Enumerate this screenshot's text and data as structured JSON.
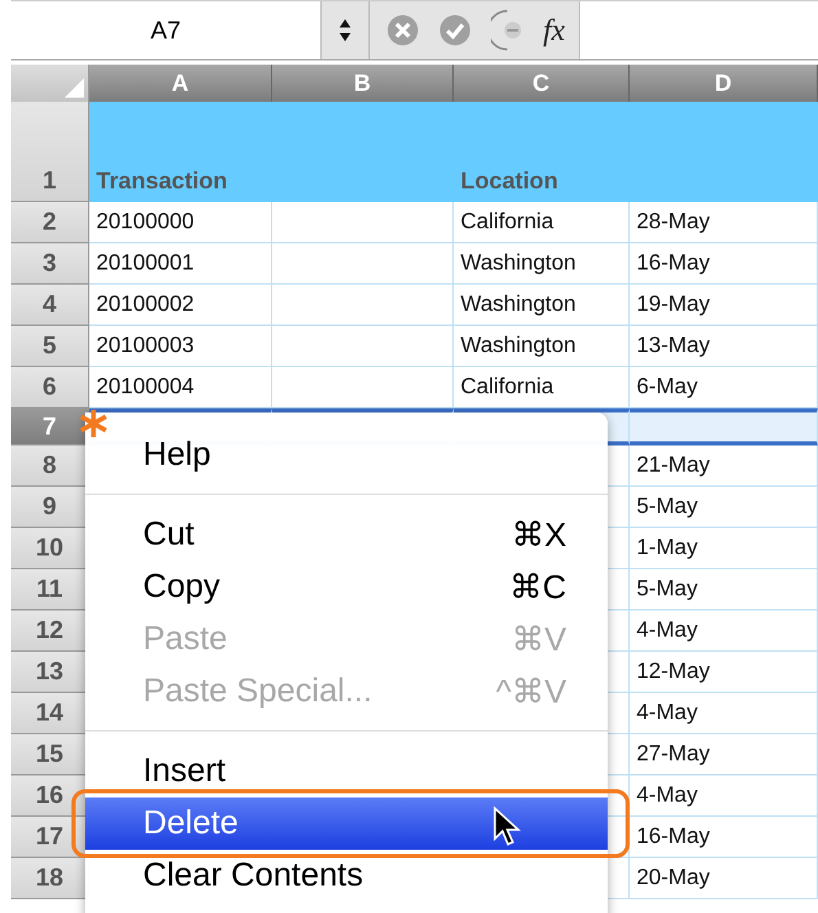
{
  "formula_bar": {
    "name_box": "A7",
    "function_label": "fx"
  },
  "columns": [
    {
      "label": "A"
    },
    {
      "label": "B"
    },
    {
      "label": "C"
    },
    {
      "label": "D"
    }
  ],
  "rows": [
    {
      "number": "1",
      "kind": "header",
      "selected": false,
      "marked": false,
      "a": "Transaction",
      "c": "Location"
    },
    {
      "number": "2",
      "kind": "data",
      "selected": false,
      "marked": false,
      "a": "20100000",
      "c": "California",
      "d": "28-May"
    },
    {
      "number": "3",
      "kind": "data",
      "selected": false,
      "marked": false,
      "a": "20100001",
      "c": "Washington",
      "d": "16-May"
    },
    {
      "number": "4",
      "kind": "data",
      "selected": false,
      "marked": false,
      "a": "20100002",
      "c": "Washington",
      "d": "19-May"
    },
    {
      "number": "5",
      "kind": "data",
      "selected": false,
      "marked": false,
      "a": "20100003",
      "c": "Washington",
      "d": "13-May"
    },
    {
      "number": "6",
      "kind": "data",
      "selected": false,
      "marked": false,
      "a": "20100004",
      "c": "California",
      "d": "6-May"
    },
    {
      "number": "7",
      "kind": "data",
      "selected": true,
      "marked": true
    },
    {
      "number": "8",
      "kind": "data",
      "selected": false,
      "marked": false,
      "d": "21-May"
    },
    {
      "number": "9",
      "kind": "data",
      "selected": false,
      "marked": false,
      "d": "5-May"
    },
    {
      "number": "10",
      "kind": "data",
      "selected": false,
      "marked": false,
      "d": "1-May"
    },
    {
      "number": "11",
      "kind": "data",
      "selected": false,
      "marked": false,
      "d": "5-May"
    },
    {
      "number": "12",
      "kind": "data",
      "selected": false,
      "marked": false,
      "d": "4-May"
    },
    {
      "number": "13",
      "kind": "data",
      "selected": false,
      "marked": false,
      "d": "12-May"
    },
    {
      "number": "14",
      "kind": "data",
      "selected": false,
      "marked": false,
      "d": "4-May"
    },
    {
      "number": "15",
      "kind": "data",
      "selected": false,
      "marked": false,
      "d": "27-May"
    },
    {
      "number": "16",
      "kind": "data",
      "selected": false,
      "marked": false,
      "d": "4-May"
    },
    {
      "number": "17",
      "kind": "data",
      "selected": false,
      "marked": false,
      "d": "16-May"
    },
    {
      "number": "18",
      "kind": "data",
      "selected": false,
      "marked": false,
      "d": "20-May"
    }
  ],
  "context_menu": [
    {
      "kind": "item",
      "label": "Help",
      "disabled": false,
      "selected": false,
      "circled": false
    },
    {
      "kind": "separator"
    },
    {
      "kind": "item",
      "label": "Cut",
      "shortcut": "⌘X",
      "disabled": false,
      "selected": false,
      "circled": false
    },
    {
      "kind": "item",
      "label": "Copy",
      "shortcut": "⌘C",
      "disabled": false,
      "selected": false,
      "circled": false
    },
    {
      "kind": "item",
      "label": "Paste",
      "shortcut": "⌘V",
      "disabled": true,
      "selected": false,
      "circled": false
    },
    {
      "kind": "item",
      "label": "Paste Special...",
      "shortcut": "^⌘V",
      "disabled": true,
      "selected": false,
      "circled": false
    },
    {
      "kind": "separator"
    },
    {
      "kind": "item",
      "label": "Insert",
      "disabled": false,
      "selected": false,
      "circled": false
    },
    {
      "kind": "item",
      "label": "Delete",
      "disabled": false,
      "selected": true,
      "circled": true
    },
    {
      "kind": "item",
      "label": "Clear Contents",
      "disabled": false,
      "selected": false,
      "circled": false
    }
  ]
}
